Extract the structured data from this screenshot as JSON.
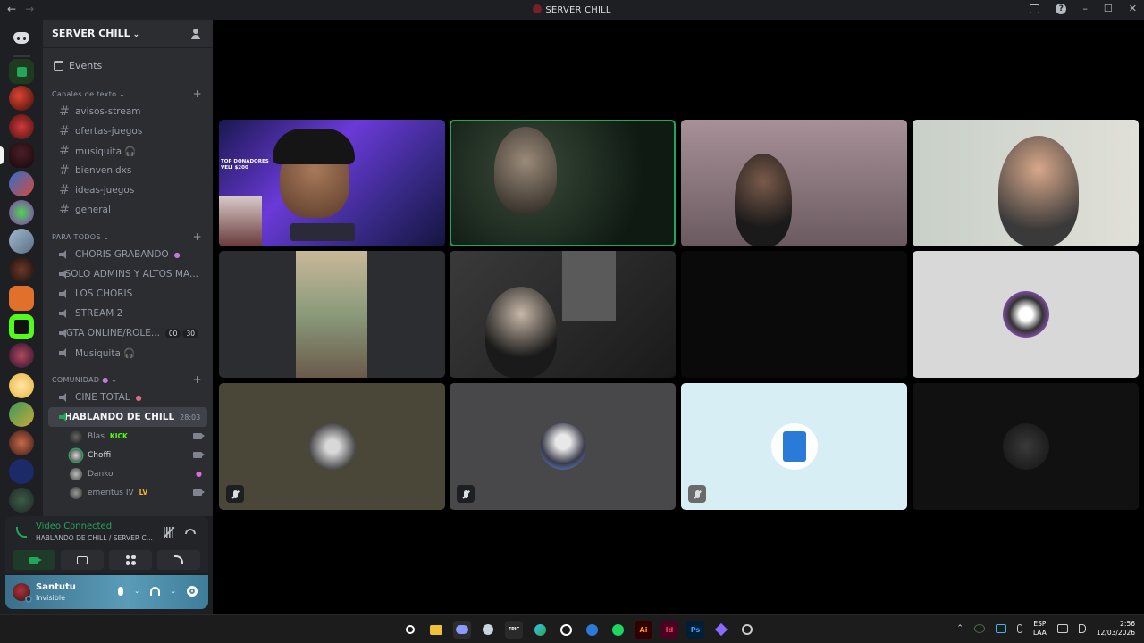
{
  "window": {
    "title": "SERVER CHILL",
    "back_label": "←",
    "forward_label": "→",
    "min_label": "–",
    "max_label": "☐",
    "close_label": "✕"
  },
  "server": {
    "name": "SERVER CHILL",
    "events_label": "Events",
    "categories": [
      {
        "label": "Canales de texto",
        "channels": [
          "avisos-stream",
          "ofertas-juegos",
          "musiquita 🎧",
          "bienvenidxs",
          "ideas-juegos",
          "general"
        ]
      },
      {
        "label": "PARA TODOS",
        "channels": [
          "CHORIS GRABANDO",
          "SOLO ADMINS Y ALTOS MA...",
          "LOS CHORIS",
          "STREAM 2",
          "GTA ONLINE/ROLE...",
          "Musiquita 🎧"
        ],
        "gta_badges": [
          "00",
          "30"
        ]
      },
      {
        "label": "COMUNIDAD",
        "channels": [
          "CINE TOTAL",
          "HABLANDO DE CHILL"
        ],
        "active_timer": "28:03"
      }
    ],
    "members": [
      {
        "name": "Blas",
        "tag": "KICK"
      },
      {
        "name": "Choffi",
        "tag": ""
      },
      {
        "name": "Danko",
        "tag": ""
      },
      {
        "name": "emeritus IV",
        "tag": "LV"
      }
    ]
  },
  "voice": {
    "status": "Video Connected",
    "channel": "HABLANDO DE CHILL / SERVER C..."
  },
  "user": {
    "name": "Santutu",
    "status": "Invisible"
  },
  "stream_overlay": {
    "line1": "TOP DONADORES",
    "line2": "VELI $200"
  },
  "taskbar": {
    "lang1": "ESP",
    "lang2": "LAA",
    "time": "2:56",
    "date": "12/03/2026",
    "apps": [
      "EPIC",
      "Ai",
      "Id",
      "Ps"
    ]
  },
  "colors": {
    "accent_green": "#23a55a",
    "sidebar": "#2b2d31",
    "rail": "#1e1f22"
  }
}
